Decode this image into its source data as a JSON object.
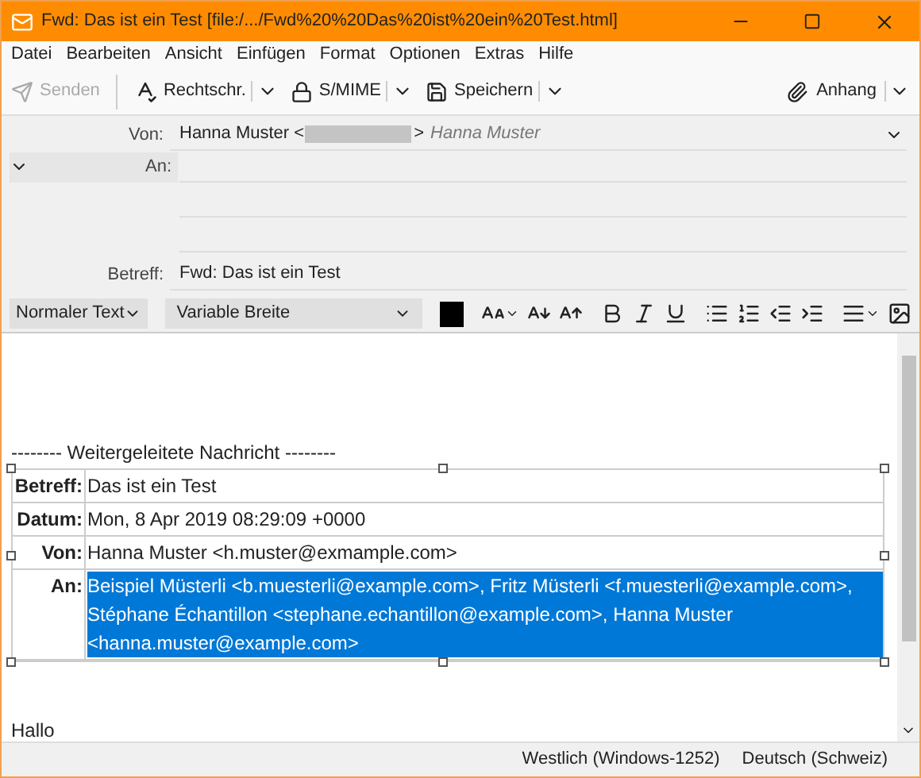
{
  "window": {
    "title": "Fwd: Das ist ein Test [file:/.../Fwd%20%20Das%20ist%20ein%20Test.html]"
  },
  "menu": [
    {
      "label": "Datei"
    },
    {
      "label": "Bearbeiten"
    },
    {
      "label": "Ansicht"
    },
    {
      "label": "Einfügen"
    },
    {
      "label": "Format"
    },
    {
      "label": "Optionen"
    },
    {
      "label": "Extras"
    },
    {
      "label": "Hilfe"
    }
  ],
  "toolbar": [
    {
      "kind": "send",
      "label": "Senden",
      "disabled": true,
      "dropdown": false
    },
    {
      "kind": "spell",
      "label": "Rechtschr.",
      "disabled": false,
      "dropdown": true
    },
    {
      "kind": "lock",
      "label": "S/MIME",
      "disabled": false,
      "dropdown": true
    },
    {
      "kind": "save",
      "label": "Speichern",
      "disabled": false,
      "dropdown": true
    }
  ],
  "attach": {
    "label": "Anhang"
  },
  "header": {
    "from_label": "Von:",
    "from_name": "Hanna Muster <",
    "from_close": ">",
    "from_identity": "Hanna Muster",
    "to_label": "An:",
    "subject_label": "Betreff:",
    "subject": "Fwd: Das ist ein Test"
  },
  "format_bar": {
    "paragraph": "Normaler Text",
    "font": "Variable Breite"
  },
  "body": {
    "forward_line": "-------- Weitergeleitete Nachricht --------",
    "fields": [
      {
        "label": "Betreff:",
        "value": "Das ist ein Test",
        "selected": false
      },
      {
        "label": "Datum:",
        "value": "Mon, 8 Apr 2019 08:29:09 +0000",
        "selected": false
      },
      {
        "label": "Von:",
        "value": "Hanna Muster <h.muster@exmample.com>",
        "selected": false
      },
      {
        "label": "An:",
        "value": "Beispiel Müsterli <b.muesterli@example.com>, Fritz Müsterli <f.muesterli@example.com>, Stéphane Échantillon <stephane.echantillon@example.com>, Hanna Muster <hanna.muster@example.com>",
        "selected": true
      }
    ],
    "greeting": "Hallo"
  },
  "status_bar": {
    "encoding": "Westlich (Windows-1252)",
    "language": "Deutsch (Schweiz)"
  }
}
